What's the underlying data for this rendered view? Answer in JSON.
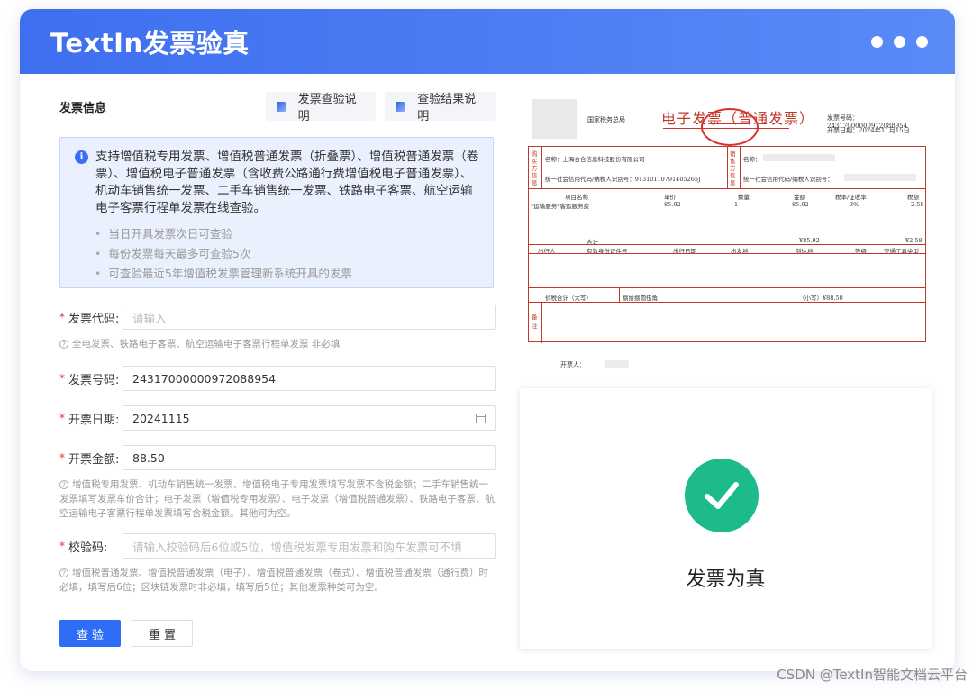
{
  "window": {
    "title": "TextIn发票验真"
  },
  "form": {
    "section_title": "发票信息",
    "help_buttons": [
      "发票查验说明",
      "查验结果说明"
    ],
    "notice": {
      "main": "支持增值税专用发票、增值税普通发票（折叠票）、增值税普通发票（卷票）、增值税电子普通发票（含收费公路通行费增值税电子普通发票）、机动车销售统一发票、二手车销售统一发票、铁路电子客票、航空运输电子客票行程单发票在线查验。",
      "bullets": [
        "当日开具发票次日可查验",
        "每份发票每天最多可查验5次",
        "可查验最近5年增值税发票管理新系统开具的发票"
      ]
    },
    "code": {
      "label": "发票代码:",
      "placeholder": "请输入",
      "hint": "全电发票、铁路电子客票、航空运输电子客票行程单发票 非必填"
    },
    "number": {
      "label": "发票号码:",
      "value": "24317000000972088954"
    },
    "date": {
      "label": "开票日期:",
      "value": "20241115"
    },
    "amount": {
      "label": "开票金额:",
      "value": "88.50",
      "hint": "增值税专用发票、机动车销售统一发票、增值税电子专用发票填写发票不含税金额；二手车销售统一发票填写发票车价合计；电子发票（增值税专用发票）、电子发票（增值税普通发票）、铁路电子客票、航空运输电子客票行程单发票填写含税金额。其他可为空。"
    },
    "check": {
      "label": "校验码:",
      "placeholder": "请输入校验码后6位或5位，增值税发票专用发票和购车发票可不填",
      "hint": "增值税普通发票、增值税普通发票（电子）、增值税普通发票（卷式）、增值税普通发票（通行费）时必填，填写后6位；区块链发票时非必填，填写后5位；其他发票种类可为空。"
    },
    "buttons": {
      "submit": "查验",
      "reset": "重置"
    }
  },
  "invoice": {
    "title": "电子发票（普通发票）",
    "sub": "国家税务总局",
    "invoice_no": "发票号码：24317000000972088954",
    "date": "开票日期：2024年11月15日",
    "buyer_label": "购买方信息",
    "buyer_name": "名称：上海合合信息科技股份有限公司",
    "buyer_tax": "统一社会信用代码/纳税人识别号：91310110791405265J",
    "seller_label": "销售方信息",
    "seller_name": "名称：",
    "seller_tax": "统一社会信用代码/纳税人识别号：",
    "col_item": "项目名称",
    "col_unit": "单价",
    "col_qty": "数量",
    "col_amount": "金额",
    "col_rate": "税率/征收率",
    "col_tax": "税额",
    "item": "*运输服务*客运服务费",
    "unit_price": "85.92",
    "qty": "1",
    "amount": "85.92",
    "rate": "3%",
    "tax": "2.58",
    "total_label": "合计",
    "total_amount": "¥85.92",
    "total_tax": "¥2.58",
    "travel_cols": [
      "出行人",
      "有效身份证件号",
      "出行日期",
      "出发地",
      "到达地",
      "等级",
      "交通工具类型"
    ],
    "sum_label": "价税合计（大写）",
    "sum_upper": "捌拾捌圆伍角",
    "sum_small": "（小写）¥88.50",
    "remark_label": "备注",
    "drawer": "开票人："
  },
  "result": {
    "text": "发票为真"
  },
  "watermark": "CSDN @TextIn智能文档云平台"
}
